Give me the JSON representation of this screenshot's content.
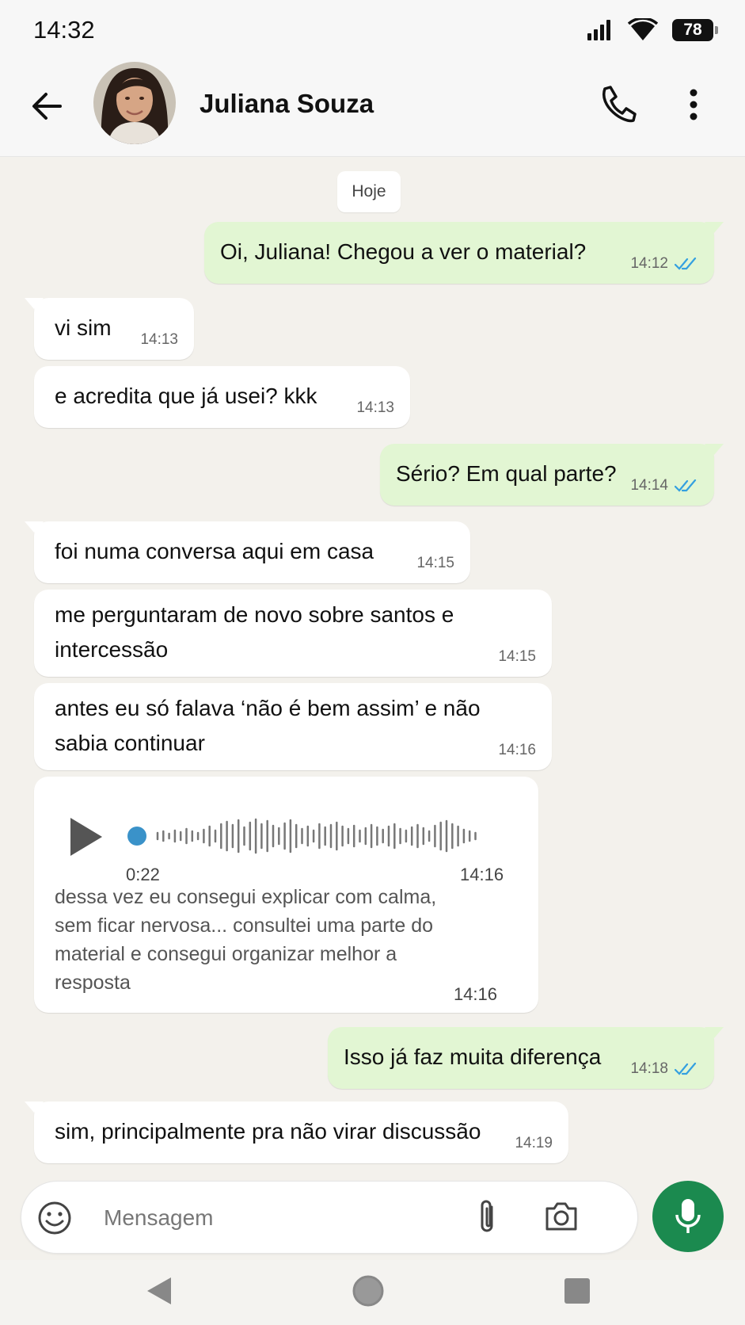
{
  "status_bar": {
    "time": "14:32",
    "battery": "78"
  },
  "header": {
    "contact_name": "Juliana Souza"
  },
  "chat": {
    "date_chip": "Hoje",
    "messages": [
      {
        "direction": "out",
        "text": "Oi, Juliana! Chegou a ver o material?",
        "time": "14:12"
      },
      {
        "direction": "in",
        "text": "vi sim",
        "time": "14:13"
      },
      {
        "direction": "in",
        "text": "e acredita que já usei? kkk",
        "time": "14:13"
      },
      {
        "direction": "out",
        "text": "Sério? Em qual parte?",
        "time": "14:14"
      },
      {
        "direction": "in",
        "text": "foi numa conversa aqui em casa",
        "time": "14:15"
      },
      {
        "direction": "in",
        "text": "me perguntaram de novo sobre santos e",
        "text_2": "intercessão",
        "time": "14:15"
      },
      {
        "direction": "in",
        "text": "antes eu só falava ‘não é bem assim’ e não",
        "text_2": "sabia continuar",
        "time": "14:16"
      },
      {
        "direction": "out",
        "text": "Isso já faz muita diferença",
        "time": "14:18"
      },
      {
        "direction": "in",
        "text": "sim, principalmente pra não virar discussão",
        "time": "14:19"
      }
    ],
    "voice_message": {
      "duration": "0:22",
      "time": "14:16",
      "transcript": "dessa vez eu consegui explicar com calma, sem ficar nervosa... consultei uma parte do material e consegui organizar melhor a resposta",
      "transcript_time": "14:16",
      "progress": 0
    }
  },
  "composer": {
    "placeholder": "Mensagem"
  },
  "colors": {
    "outgoing_bubble": "#e2f6d3",
    "incoming_bubble": "#ffffff",
    "accent": "#1b8a4f",
    "read_ticks": "#34a0e0"
  }
}
